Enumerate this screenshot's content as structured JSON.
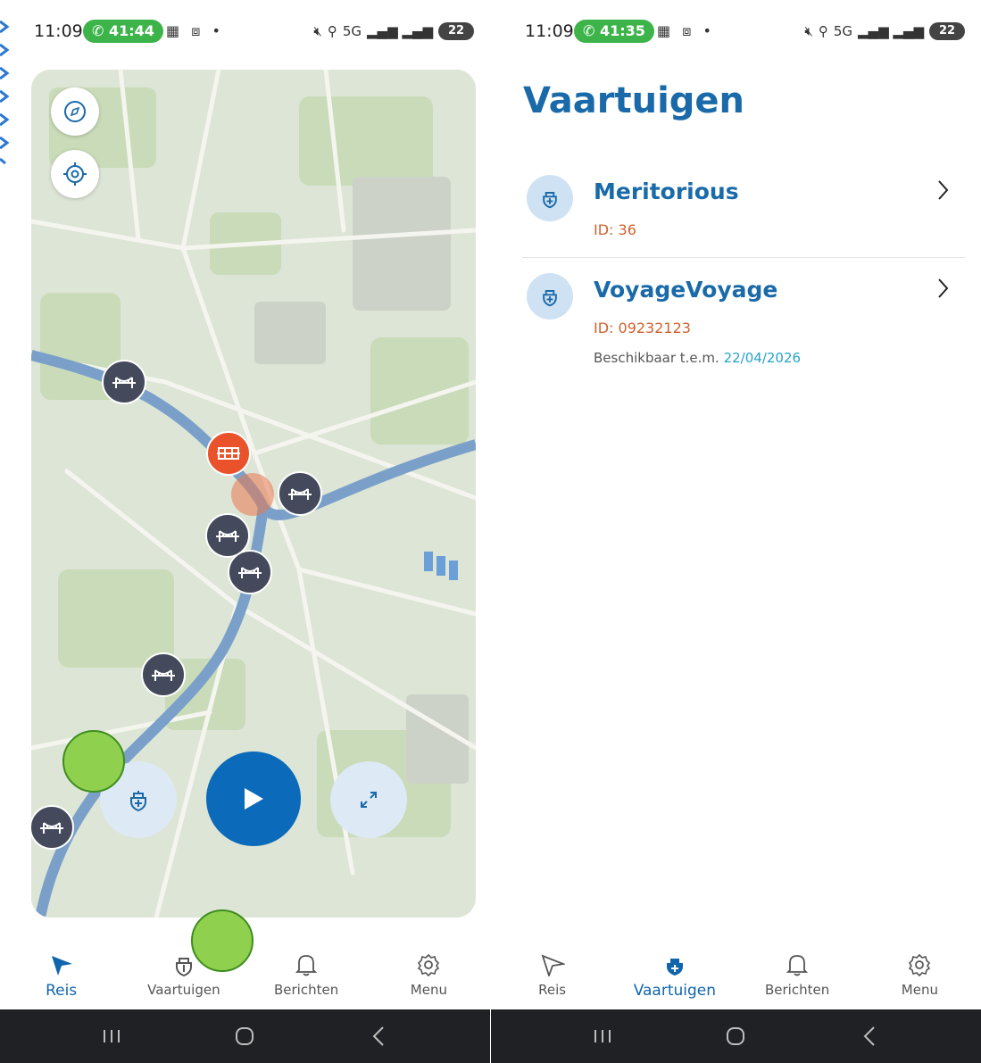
{
  "left_screen": {
    "status": {
      "time": "11:09",
      "call_timer": "41:44",
      "battery": "22",
      "network": "5G"
    },
    "map_buttons": {
      "compass_icon": "compass-icon",
      "locate_icon": "crosshair-icon"
    },
    "markers": {
      "bridge_icon": "bridge-icon",
      "lock_icon": "lock-icon"
    },
    "fab": {
      "vessel_icon": "ship-icon",
      "play_icon": "play-icon",
      "expand_icon": "expand-icon"
    },
    "nav": [
      {
        "label": "Reis",
        "icon": "navigation-arrow-icon",
        "active": true
      },
      {
        "label": "Vaartuigen",
        "icon": "ship-icon",
        "active": false
      },
      {
        "label": "Berichten",
        "icon": "bell-icon",
        "active": false
      },
      {
        "label": "Menu",
        "icon": "gear-icon",
        "active": false
      }
    ]
  },
  "right_screen": {
    "status": {
      "time": "11:09",
      "call_timer": "41:35",
      "battery": "22",
      "network": "5G"
    },
    "title": "Vaartuigen",
    "vessels": [
      {
        "name": "Meritorious",
        "id": "ID: 36"
      },
      {
        "name": "VoyageVoyage",
        "id": "ID: 09232123",
        "available_label": "Beschikbaar t.e.m.",
        "available_date": "22/04/2026"
      }
    ],
    "nav": [
      {
        "label": "Reis",
        "icon": "navigation-arrow-icon",
        "active": false
      },
      {
        "label": "Vaartuigen",
        "icon": "ship-icon",
        "active": true
      },
      {
        "label": "Berichten",
        "icon": "bell-icon",
        "active": false
      },
      {
        "label": "Menu",
        "icon": "gear-icon",
        "active": false
      }
    ]
  },
  "colors": {
    "primary": "#1a6aa9",
    "accent_orange": "#d0612e",
    "bridge_marker": "#444a5c",
    "lock_marker": "#e9522a",
    "play_button": "#0b6ab9",
    "call_green": "#3db44a"
  }
}
